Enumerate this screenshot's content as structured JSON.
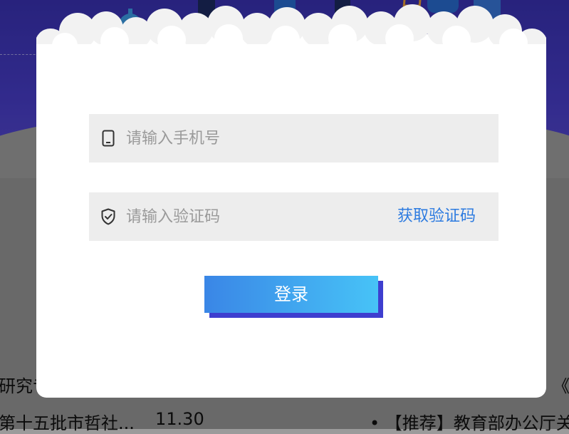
{
  "login_form": {
    "phone_placeholder": "请输入手机号",
    "code_placeholder": "请输入验证码",
    "get_code_label": "获取验证码",
    "login_label": "登录"
  },
  "background": {
    "left_heading_fragment": "研究专",
    "right_heading_fragment": "《",
    "news_left": {
      "title": "第十五批市哲社...",
      "date": "11.30"
    },
    "news_right": {
      "title": "• 【推荐】教育部办公厅关"
    }
  },
  "colors": {
    "header_blue": "#3b33b8",
    "accent_blue": "#2d7be0",
    "button_gradient_start": "#3a86e6",
    "button_gradient_end": "#47c3f7"
  }
}
